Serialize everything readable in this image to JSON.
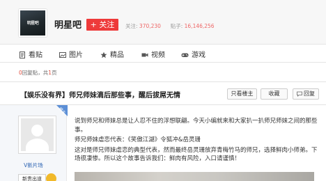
{
  "header": {
    "logo_text": "明星吧",
    "forum_name": "明星吧",
    "follow_label": "+ 关注",
    "followers_label": "关注:",
    "followers_count": "370,230",
    "posts_label": "贴子:",
    "posts_count": "16,146,256"
  },
  "nav": {
    "items": [
      {
        "label": "看贴",
        "icon": "document-icon"
      },
      {
        "label": "图片",
        "icon": "image-icon"
      },
      {
        "label": "精品",
        "icon": "star-icon"
      },
      {
        "label": "视频",
        "icon": "video-icon"
      },
      {
        "label": "游戏",
        "icon": "gamepad-icon"
      }
    ]
  },
  "post_info": {
    "reply_count": "0",
    "reply_label": "回复贴，共",
    "page_count": "1",
    "page_label": "页"
  },
  "thread": {
    "title": "【娱乐没有界】师兄师妹滴后那些事，醒后拔屌无情",
    "only_author_label": "只看楼主",
    "favorite_label": "收藏",
    "reply_label": "回复"
  },
  "author": {
    "name": "V新片场",
    "badge_new": "新贵出道",
    "corner_label": "楼主"
  },
  "content": {
    "paragraphs": [
      "说到师兄和师妹总是让人忍不住的浮想联翩。今天小编就来和大家扒一扒师兄师妹之间的那些事。",
      "师兄师妹虐恋代表：《笑傲江湖》令狐冲&岳灵珊",
      "这对是师兄师妹虐恋的典型代表，然而最终岳灵珊放弃青梅竹马的师兄，选择鲜肉小师弟。下场很凄惨。所以这个故事告诉我们：鲜肉有风险，入口请谨慎！"
    ]
  },
  "colors": {
    "accent_red": "#ee3a3a",
    "link_blue": "#2d64b3",
    "corner_blue": "#5c8fd6"
  }
}
